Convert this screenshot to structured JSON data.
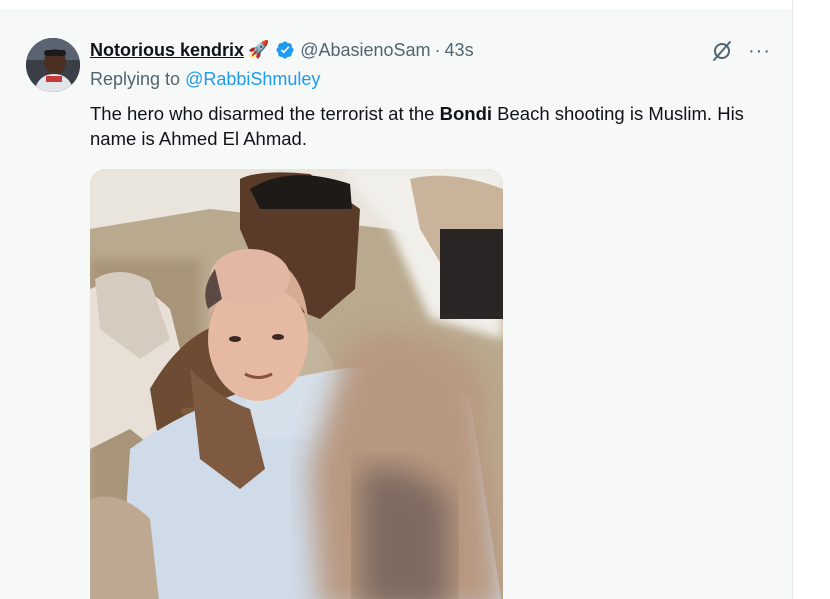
{
  "tweet": {
    "display_name": "Notorious kendrix",
    "name_emoji": "🚀",
    "handle": "@AbasienoSam",
    "separator": "·",
    "time": "43s",
    "reply_prefix": "Replying to",
    "reply_to": "@RabbiShmuley",
    "text_part1": "The hero who disarmed the terrorist at the ",
    "text_bold": "Bondi",
    "text_part2": " Beach shooting is Muslim. His name is Ahmed El Ahmad.",
    "more_label": "···"
  },
  "icons": {
    "verified": "verified-badge-icon",
    "grok": "grok-icon",
    "more": "more-icon"
  },
  "colors": {
    "accent": "#1d9bf0",
    "secondary_text": "#536471",
    "background": "#f7f9f9"
  }
}
